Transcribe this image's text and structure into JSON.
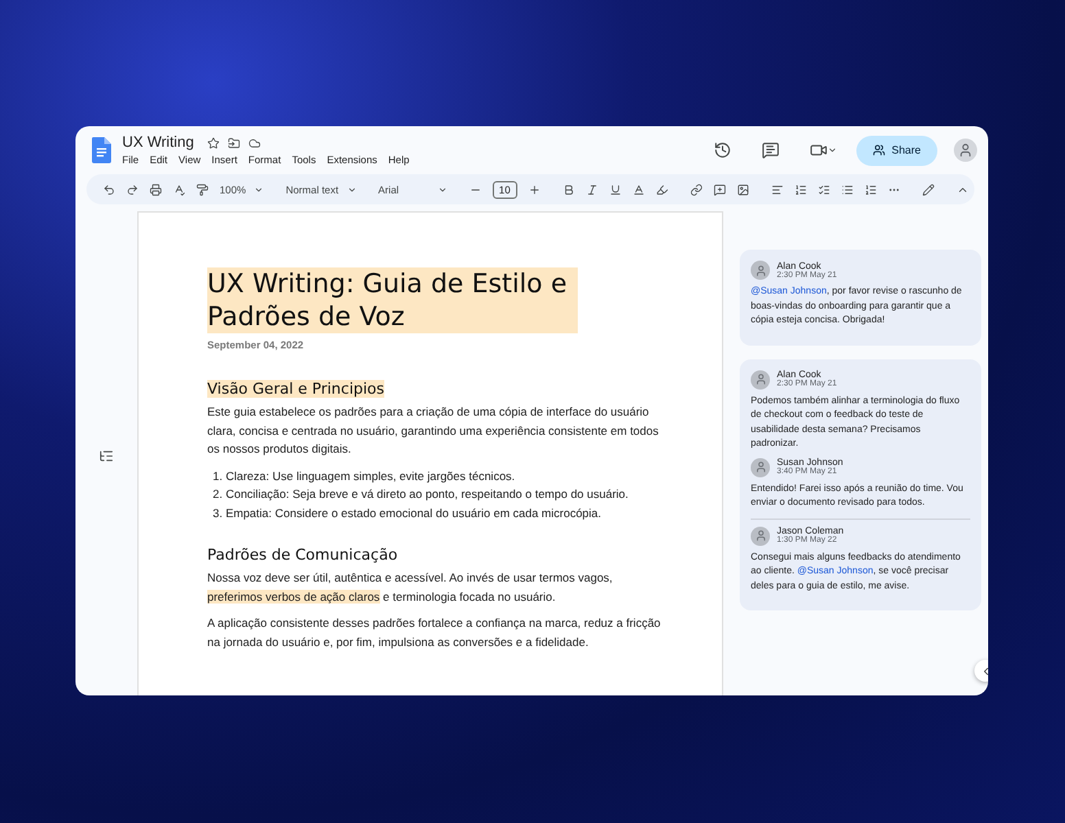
{
  "window": {
    "title": "UX Writing",
    "menu": [
      "File",
      "Edit",
      "View",
      "Insert",
      "Format",
      "Tools",
      "Extensions",
      "Help"
    ],
    "share": "Share"
  },
  "toolbar": {
    "zoom": "100%",
    "style": "Normal text",
    "font": "Arial",
    "size": "10"
  },
  "document": {
    "title": {
      "text": "UX Writing: Guia de Estilo e Padrões de Voz",
      "highlighted": true
    },
    "date": "September 04, 2022",
    "sections": [
      {
        "heading": "Visão Geral e Principios",
        "highlighted": true,
        "blocks": [
          {
            "kind": "paragraph",
            "segments": [
              {
                "text": "Este guia estabelece os padrões para a criação de uma cópia de interface do usuário clara, concisa e centrada no usuário, garantindo uma experiência consistente em todos os nossos produtos digitais.",
                "highlighted": false
              }
            ]
          },
          {
            "kind": "list",
            "items": [
              "1. Clareza: Use linguagem simples, evite jargões técnicos.",
              "2. Conciliação: Seja breve e vá direto ao ponto, respeitando o tempo do usuário.",
              "3. Empatia: Considere o estado emocional do usuário em cada microcópia."
            ]
          }
        ]
      },
      {
        "heading": "Padrões de Comunicação",
        "highlighted": false,
        "blocks": [
          {
            "kind": "paragraph",
            "segments": [
              {
                "text": "Nossa voz deve ser útil, autêntica e acessível. Ao invés de usar termos vagos, ",
                "highlighted": false
              },
              {
                "text": "preferimos verbos de ação claros",
                "highlighted": true
              },
              {
                "text": " e terminologia focada no usuário.",
                "highlighted": false
              }
            ]
          },
          {
            "kind": "paragraph",
            "segments": [
              {
                "text": "A aplicação consistente desses padrões fortalece a confiança na marca, reduz a fricção na jornada do usuário e, por fim, impulsiona as conversões e a fidelidade.",
                "highlighted": false
              }
            ]
          }
        ]
      }
    ]
  },
  "comments": [
    [
      {
        "author": "Alan Cook",
        "time": "2:30 PM May 21",
        "segments": [
          {
            "kind": "mention",
            "text": "@Susan Johnson"
          },
          {
            "kind": "text",
            "text": ", por favor revise o rascunho de boas-vindas do onboarding para garantir que a cópia esteja concisa. Obrigada!"
          }
        ]
      }
    ],
    [
      {
        "author": "Alan Cook",
        "time": "2:30 PM May 21",
        "segments": [
          {
            "kind": "text",
            "text": "Podemos também alinhar a terminologia do fluxo de checkout com o feedback do teste de usabilidade desta semana? Precisamos padronizar."
          }
        ]
      },
      {
        "author": "Susan Johnson",
        "time": "3:40 PM May 21",
        "segments": [
          {
            "kind": "text",
            "text": "Entendido! Farei isso após a reunião do time. Vou enviar o documento revisado para todos."
          }
        ]
      },
      {
        "author": "Jason Coleman",
        "time": "1:30 PM May 22",
        "segments": [
          {
            "kind": "text",
            "text": "Consegui mais alguns feedbacks do atendimento ao cliente. "
          },
          {
            "kind": "mention",
            "text": "@Susan Johnson"
          },
          {
            "kind": "text",
            "text": ", se você precisar deles para o guia de estilo, me avise."
          }
        ]
      }
    ]
  ]
}
